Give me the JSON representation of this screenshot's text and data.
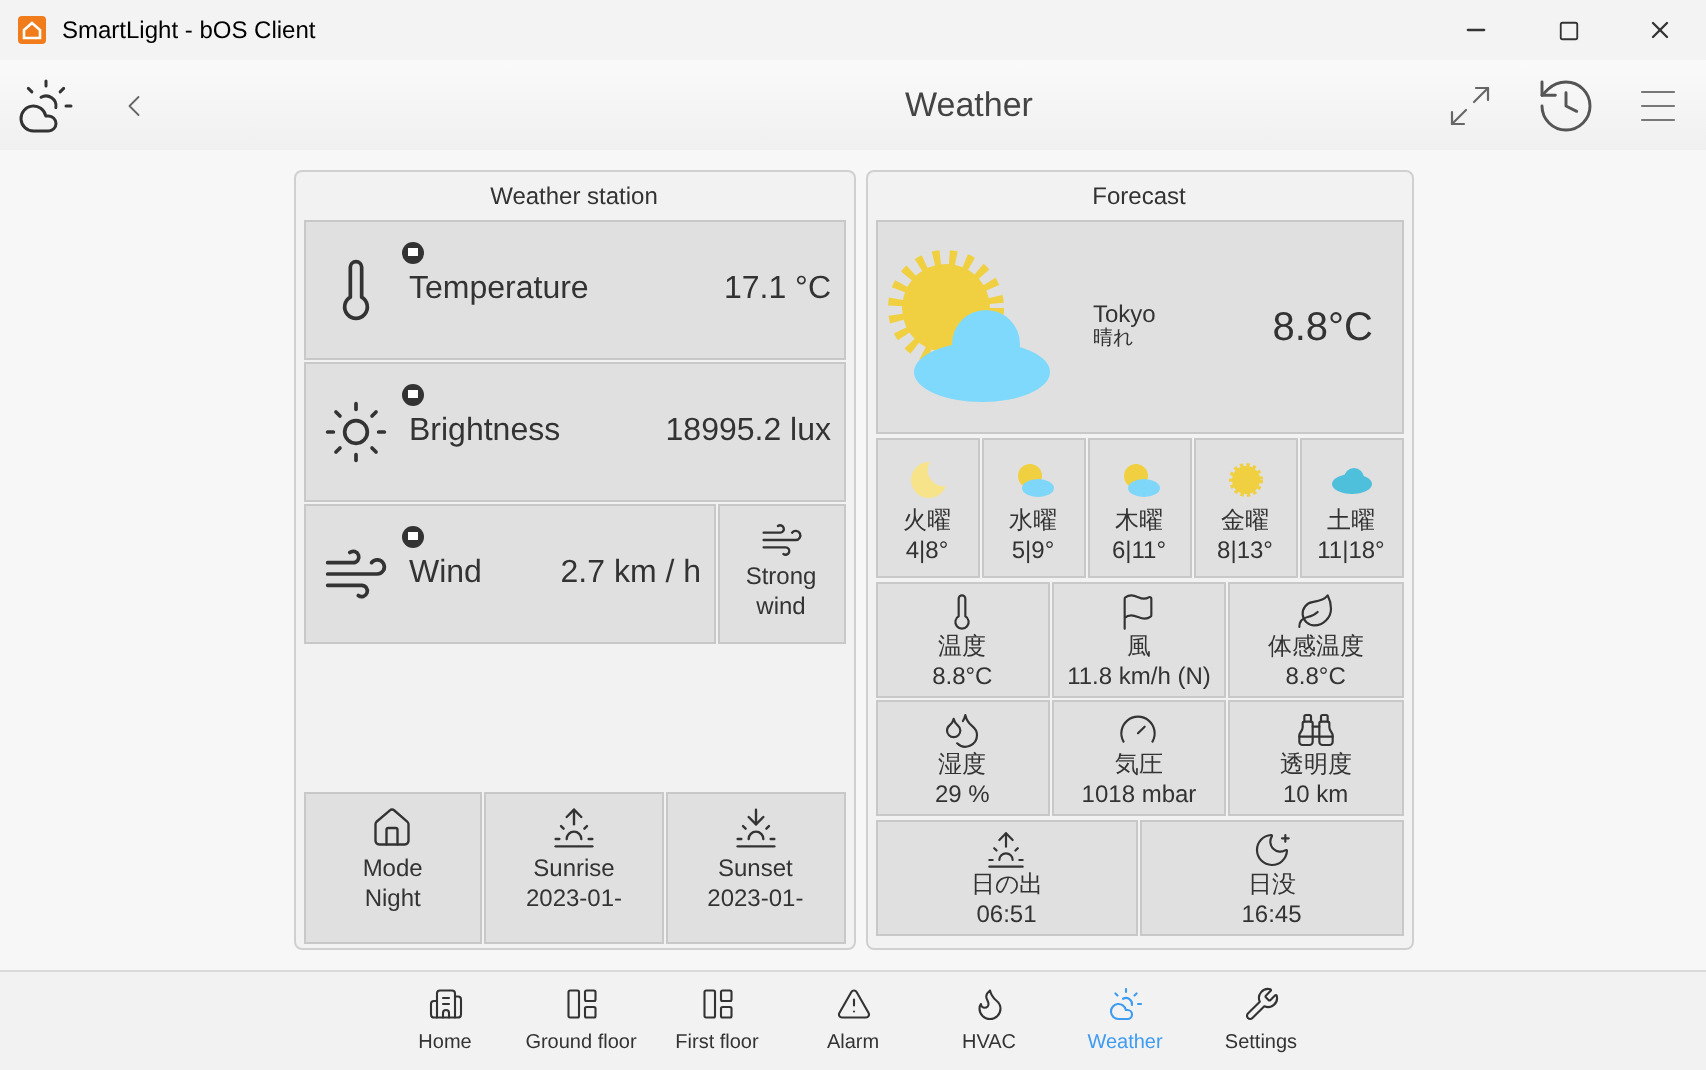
{
  "window": {
    "title": "SmartLight - bOS Client"
  },
  "header": {
    "title": "Weather"
  },
  "weather_station": {
    "title": "Weather station",
    "sensors": [
      {
        "kind": "temperature",
        "label": "Temperature",
        "value": "17.1 °C"
      },
      {
        "kind": "brightness",
        "label": "Brightness",
        "value": "18995.2 lux"
      },
      {
        "kind": "wind",
        "label": "Wind",
        "value": "2.7 km / h"
      }
    ],
    "wind_alert": {
      "label": "Strong wind"
    },
    "tiles": [
      {
        "kind": "mode",
        "label": "Mode",
        "value": "Night"
      },
      {
        "kind": "sunrise",
        "label": "Sunrise",
        "value": "2023-01-"
      },
      {
        "kind": "sunset",
        "label": "Sunset",
        "value": "2023-01-"
      }
    ]
  },
  "forecast": {
    "title": "Forecast",
    "current": {
      "city": "Tokyo",
      "condition": "晴れ",
      "temperature": "8.8°C"
    },
    "days": [
      {
        "kind": "moon",
        "day": "火曜",
        "range": "4|8°"
      },
      {
        "kind": "partly_cloudy",
        "day": "水曜",
        "range": "5|9°"
      },
      {
        "kind": "partly_cloudy",
        "day": "木曜",
        "range": "6|11°"
      },
      {
        "kind": "sunny",
        "day": "金曜",
        "range": "8|13°"
      },
      {
        "kind": "cloudy",
        "day": "土曜",
        "range": "11|18°"
      }
    ],
    "details": [
      {
        "kind": "thermometer",
        "label": "温度",
        "value": "8.8°C"
      },
      {
        "kind": "windsock",
        "label": "風",
        "value": "11.8 km/h (N)"
      },
      {
        "kind": "leaf",
        "label": "体感温度",
        "value": "8.8°C"
      },
      {
        "kind": "drops",
        "label": "湿度",
        "value": "29 %"
      },
      {
        "kind": "gauge",
        "label": "気圧",
        "value": "1018 mbar"
      },
      {
        "kind": "binoculars",
        "label": "透明度",
        "value": "10 km"
      }
    ],
    "sun": [
      {
        "kind": "sunrise",
        "label": "日の出",
        "value": "06:51"
      },
      {
        "kind": "moon",
        "label": "日没",
        "value": "16:45"
      }
    ]
  },
  "nav": [
    {
      "kind": "building",
      "label": "Home",
      "selected": false
    },
    {
      "kind": "floor",
      "label": "Ground floor",
      "selected": false
    },
    {
      "kind": "floor",
      "label": "First floor",
      "selected": false
    },
    {
      "kind": "alarm",
      "label": "Alarm",
      "selected": false
    },
    {
      "kind": "flame",
      "label": "HVAC",
      "selected": false
    },
    {
      "kind": "weather",
      "label": "Weather",
      "selected": true
    },
    {
      "kind": "wrench",
      "label": "Settings",
      "selected": false
    }
  ]
}
